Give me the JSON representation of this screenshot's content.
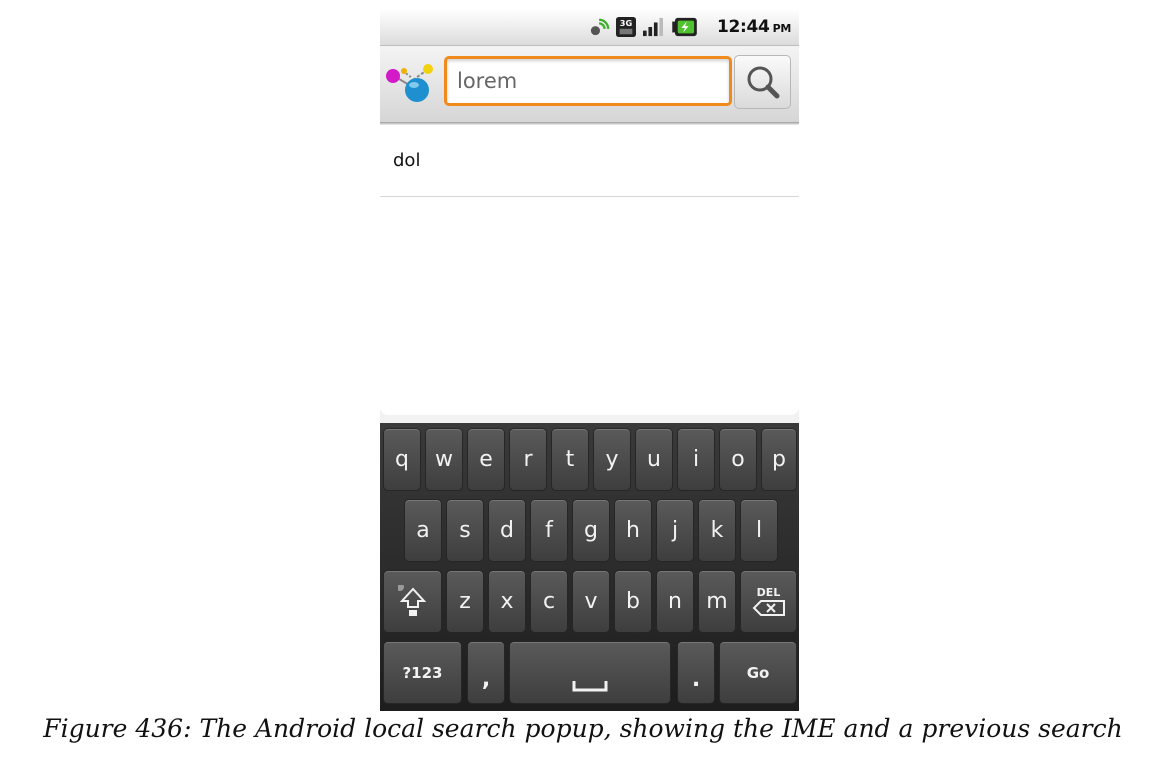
{
  "status_bar": {
    "time": "12:44",
    "ampm": "PM",
    "network_label": "3G",
    "icons": [
      "sync-satellite-icon",
      "3g-network-icon",
      "signal-strength-icon",
      "battery-charging-icon"
    ]
  },
  "search": {
    "query": "lorem",
    "app_icon": "molecule-app-icon",
    "button_icon": "magnifier-icon"
  },
  "suggestions": [
    {
      "text": "dol"
    }
  ],
  "keyboard": {
    "row1": [
      "q",
      "w",
      "e",
      "r",
      "t",
      "y",
      "u",
      "i",
      "o",
      "p"
    ],
    "row2": [
      "a",
      "s",
      "d",
      "f",
      "g",
      "h",
      "j",
      "k",
      "l"
    ],
    "row3": [
      "z",
      "x",
      "c",
      "v",
      "b",
      "n",
      "m"
    ],
    "shift_icon": "shift-arrow-icon",
    "del_label": "DEL",
    "symbols_label": "?123",
    "comma_label": ",",
    "space_icon": "space-bar-icon",
    "period_label": ".",
    "go_label": "Go"
  },
  "caption": "Figure 436: The Android local search popup, showing the IME and a previous search",
  "colors": {
    "focus_border": "#f08a1c",
    "keyboard_bg": "#2a2a2a",
    "key_bg": "#4a4a4a"
  }
}
